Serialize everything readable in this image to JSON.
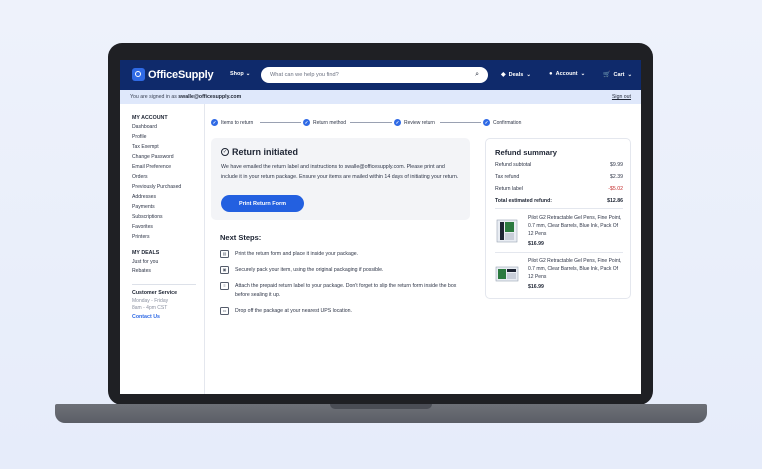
{
  "header": {
    "logo": "OfficeSupply",
    "shop": "Shop",
    "search_placeholder": "What can we help you find?",
    "deals": "Deals",
    "account": "Account",
    "cart": "Cart"
  },
  "signin": {
    "prefix": "You are signed in as",
    "email": "swalle@officesupply.com",
    "sign_out": "Sign out"
  },
  "sidebar": {
    "account_heading": "MY ACCOUNT",
    "account_items": [
      "Dashboard",
      "Profile",
      "Tax Exempt",
      "Change Password",
      "Email Preference",
      "Orders",
      "Previously Purchased",
      "Addresses",
      "Payments",
      "Subscriptions",
      "Favorites",
      "Printers"
    ],
    "deals_heading": "MY DEALS",
    "deals_items": [
      "Just for you",
      "Rebates"
    ],
    "service_heading": "Customer Service",
    "service_hours": [
      "Monday - Friday",
      "8am - 4pm CST"
    ],
    "contact": "Contact Us"
  },
  "steps": [
    "Items to return",
    "Return method",
    "Review return",
    "Confirmation"
  ],
  "return_card": {
    "title": "Return initiated",
    "body": "We have emailed the return label and instructions to swalle@officesupply.com. Please print and include it in your return package. Ensure your items are mailed within 14 days of initiating your return.",
    "button": "Print Return Form"
  },
  "next_steps": {
    "title": "Next Steps:",
    "items": [
      {
        "icon": "printer-icon",
        "text": "Print the return form and place it inside your package."
      },
      {
        "icon": "package-icon",
        "text": "Securely pack your item, using the original packaging if possible."
      },
      {
        "icon": "label-icon",
        "text": "Attach the prepaid return label to your package. Don't forget to slip the return form inside the box before sealing it up."
      },
      {
        "icon": "truck-icon",
        "text": "Drop off the package at your nearest UPS location."
      }
    ]
  },
  "refund_summary": {
    "title": "Refund summary",
    "rows": [
      {
        "label": "Refund subtotal",
        "value": "$9.99"
      },
      {
        "label": "Tax refund",
        "value": "$2.39"
      },
      {
        "label": "Return label",
        "value": "-$5.02"
      }
    ],
    "total_label": "Total estimated refund:",
    "total_value": "$12.86",
    "products": [
      {
        "name": "Pilot G2 Retractable Gel Pens, Fine Point, 0.7 mm, Clear Barrels, Blue Ink, Pack Of 12 Pens",
        "price": "$16.99"
      },
      {
        "name": "Pilot G2 Retractable Gel Pens, Fine Point, 0.7 mm, Clear Barrels, Blue Ink, Pack Of 12 Pens",
        "price": "$16.99"
      }
    ]
  },
  "colors": {
    "brand_navy": "#0f2a6b",
    "accent_blue": "#2360e0",
    "negative": "#c42b2b"
  }
}
